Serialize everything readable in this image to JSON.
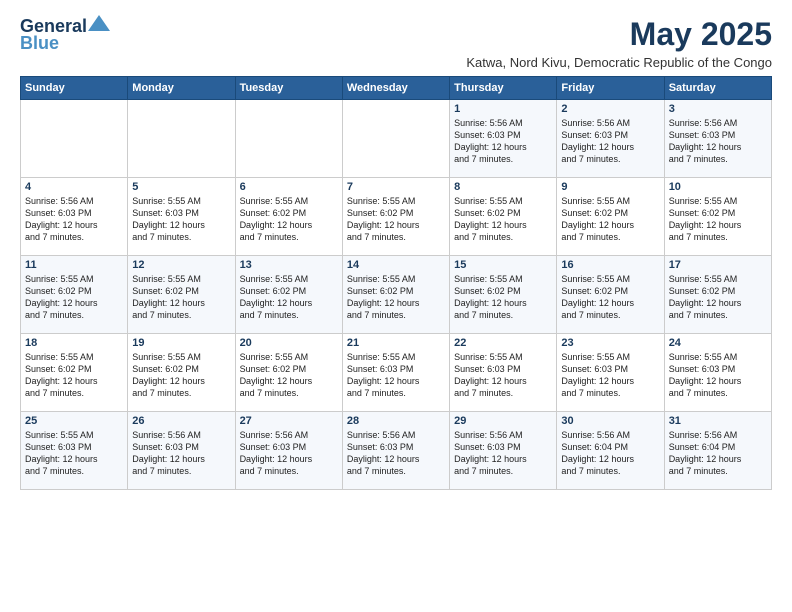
{
  "header": {
    "logo": {
      "line1": "General",
      "line2": "Blue",
      "tagline": ""
    },
    "title": "May 2025",
    "subtitle": "Katwa, Nord Kivu, Democratic Republic of the Congo"
  },
  "weekdays": [
    "Sunday",
    "Monday",
    "Tuesday",
    "Wednesday",
    "Thursday",
    "Friday",
    "Saturday"
  ],
  "weeks": [
    [
      {
        "day": "",
        "info": ""
      },
      {
        "day": "",
        "info": ""
      },
      {
        "day": "",
        "info": ""
      },
      {
        "day": "",
        "info": ""
      },
      {
        "day": "1",
        "info": "Sunrise: 5:56 AM\nSunset: 6:03 PM\nDaylight: 12 hours\nand 7 minutes."
      },
      {
        "day": "2",
        "info": "Sunrise: 5:56 AM\nSunset: 6:03 PM\nDaylight: 12 hours\nand 7 minutes."
      },
      {
        "day": "3",
        "info": "Sunrise: 5:56 AM\nSunset: 6:03 PM\nDaylight: 12 hours\nand 7 minutes."
      }
    ],
    [
      {
        "day": "4",
        "info": "Sunrise: 5:56 AM\nSunset: 6:03 PM\nDaylight: 12 hours\nand 7 minutes."
      },
      {
        "day": "5",
        "info": "Sunrise: 5:55 AM\nSunset: 6:03 PM\nDaylight: 12 hours\nand 7 minutes."
      },
      {
        "day": "6",
        "info": "Sunrise: 5:55 AM\nSunset: 6:02 PM\nDaylight: 12 hours\nand 7 minutes."
      },
      {
        "day": "7",
        "info": "Sunrise: 5:55 AM\nSunset: 6:02 PM\nDaylight: 12 hours\nand 7 minutes."
      },
      {
        "day": "8",
        "info": "Sunrise: 5:55 AM\nSunset: 6:02 PM\nDaylight: 12 hours\nand 7 minutes."
      },
      {
        "day": "9",
        "info": "Sunrise: 5:55 AM\nSunset: 6:02 PM\nDaylight: 12 hours\nand 7 minutes."
      },
      {
        "day": "10",
        "info": "Sunrise: 5:55 AM\nSunset: 6:02 PM\nDaylight: 12 hours\nand 7 minutes."
      }
    ],
    [
      {
        "day": "11",
        "info": "Sunrise: 5:55 AM\nSunset: 6:02 PM\nDaylight: 12 hours\nand 7 minutes."
      },
      {
        "day": "12",
        "info": "Sunrise: 5:55 AM\nSunset: 6:02 PM\nDaylight: 12 hours\nand 7 minutes."
      },
      {
        "day": "13",
        "info": "Sunrise: 5:55 AM\nSunset: 6:02 PM\nDaylight: 12 hours\nand 7 minutes."
      },
      {
        "day": "14",
        "info": "Sunrise: 5:55 AM\nSunset: 6:02 PM\nDaylight: 12 hours\nand 7 minutes."
      },
      {
        "day": "15",
        "info": "Sunrise: 5:55 AM\nSunset: 6:02 PM\nDaylight: 12 hours\nand 7 minutes."
      },
      {
        "day": "16",
        "info": "Sunrise: 5:55 AM\nSunset: 6:02 PM\nDaylight: 12 hours\nand 7 minutes."
      },
      {
        "day": "17",
        "info": "Sunrise: 5:55 AM\nSunset: 6:02 PM\nDaylight: 12 hours\nand 7 minutes."
      }
    ],
    [
      {
        "day": "18",
        "info": "Sunrise: 5:55 AM\nSunset: 6:02 PM\nDaylight: 12 hours\nand 7 minutes."
      },
      {
        "day": "19",
        "info": "Sunrise: 5:55 AM\nSunset: 6:02 PM\nDaylight: 12 hours\nand 7 minutes."
      },
      {
        "day": "20",
        "info": "Sunrise: 5:55 AM\nSunset: 6:02 PM\nDaylight: 12 hours\nand 7 minutes."
      },
      {
        "day": "21",
        "info": "Sunrise: 5:55 AM\nSunset: 6:03 PM\nDaylight: 12 hours\nand 7 minutes."
      },
      {
        "day": "22",
        "info": "Sunrise: 5:55 AM\nSunset: 6:03 PM\nDaylight: 12 hours\nand 7 minutes."
      },
      {
        "day": "23",
        "info": "Sunrise: 5:55 AM\nSunset: 6:03 PM\nDaylight: 12 hours\nand 7 minutes."
      },
      {
        "day": "24",
        "info": "Sunrise: 5:55 AM\nSunset: 6:03 PM\nDaylight: 12 hours\nand 7 minutes."
      }
    ],
    [
      {
        "day": "25",
        "info": "Sunrise: 5:55 AM\nSunset: 6:03 PM\nDaylight: 12 hours\nand 7 minutes."
      },
      {
        "day": "26",
        "info": "Sunrise: 5:56 AM\nSunset: 6:03 PM\nDaylight: 12 hours\nand 7 minutes."
      },
      {
        "day": "27",
        "info": "Sunrise: 5:56 AM\nSunset: 6:03 PM\nDaylight: 12 hours\nand 7 minutes."
      },
      {
        "day": "28",
        "info": "Sunrise: 5:56 AM\nSunset: 6:03 PM\nDaylight: 12 hours\nand 7 minutes."
      },
      {
        "day": "29",
        "info": "Sunrise: 5:56 AM\nSunset: 6:03 PM\nDaylight: 12 hours\nand 7 minutes."
      },
      {
        "day": "30",
        "info": "Sunrise: 5:56 AM\nSunset: 6:04 PM\nDaylight: 12 hours\nand 7 minutes."
      },
      {
        "day": "31",
        "info": "Sunrise: 5:56 AM\nSunset: 6:04 PM\nDaylight: 12 hours\nand 7 minutes."
      }
    ]
  ]
}
